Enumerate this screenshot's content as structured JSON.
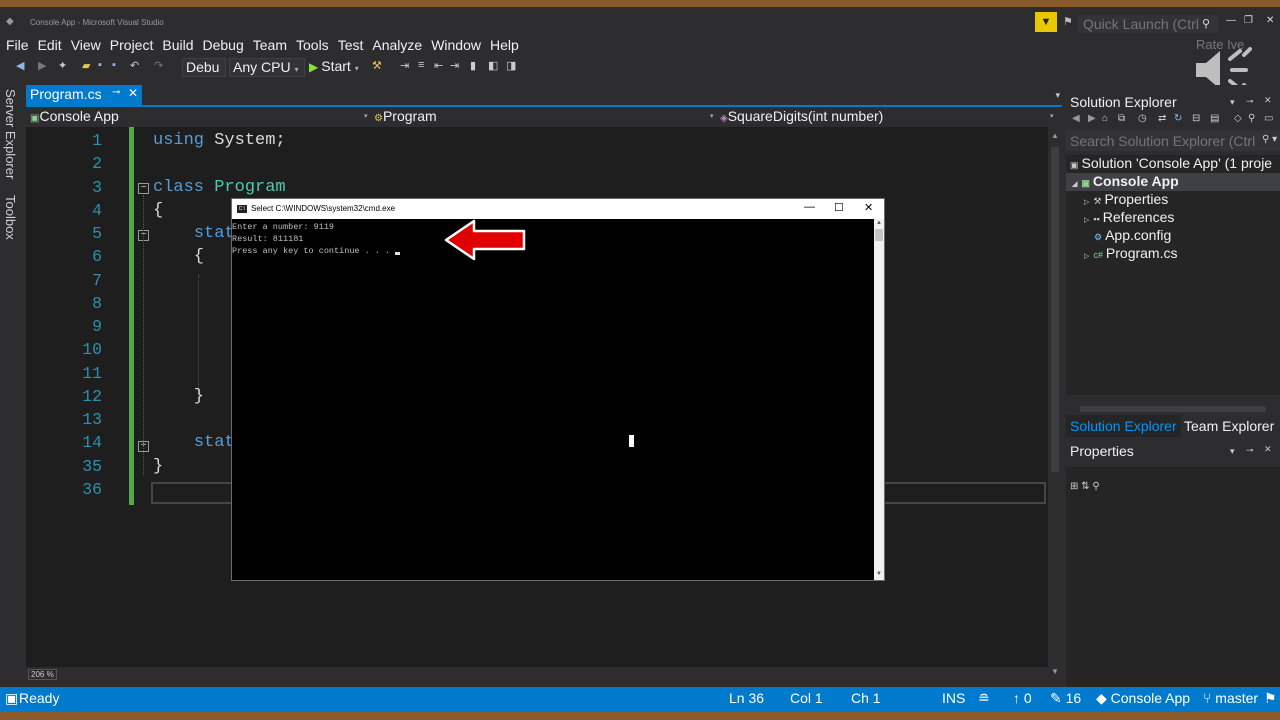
{
  "window": {
    "title": "Console App - Microsoft Visual Studio",
    "quick_launch_placeholder": "Quick Launch (Ctrl",
    "rate_label": "Rate Ive"
  },
  "menu": [
    "File",
    "Edit",
    "View",
    "Project",
    "Build",
    "Debug",
    "Team",
    "Tools",
    "Test",
    "Analyze",
    "Window",
    "Help"
  ],
  "toolbar": {
    "config": "Debu",
    "platform": "Any CPU",
    "start_label": "Start"
  },
  "side_tabs": [
    "Server Explorer",
    "Toolbox"
  ],
  "document_tab": {
    "label": "Program.cs",
    "close": "✕"
  },
  "navbar": {
    "project": "Console App",
    "type": "Program",
    "member": "SquareDigits(int number)"
  },
  "editor": {
    "line_numbers": [
      "1",
      "2",
      "3",
      "4",
      "5",
      "6",
      "7",
      "8",
      "9",
      "10",
      "11",
      "12",
      "13",
      "14",
      "35",
      "36"
    ],
    "zoom": "206 %"
  },
  "cmd": {
    "title": "Select C:\\WINDOWS\\system32\\cmd.exe",
    "lines": [
      "Enter a number: 9119",
      "Result: 811181",
      "Press any key to continue . . ."
    ]
  },
  "solution_explorer": {
    "title": "Solution Explorer",
    "search_placeholder": "Search Solution Explorer (Ctrl",
    "items": [
      {
        "label": "Solution 'Console App' (1 proje"
      },
      {
        "label": "Console App"
      },
      {
        "label": "Properties"
      },
      {
        "label": "References"
      },
      {
        "label": "App.config"
      },
      {
        "label": "Program.cs"
      }
    ],
    "tabs": [
      "Solution Explorer",
      "Team Explorer"
    ]
  },
  "properties": {
    "title": "Properties"
  },
  "status": {
    "state": "Ready",
    "ln": "Ln 36",
    "col": "Col 1",
    "ch": "Ch 1",
    "mode": "INS",
    "pending": "0",
    "commits": "16",
    "repo": "Console App",
    "branch": "master"
  },
  "colors": {
    "accent": "#007acc",
    "editor_bg": "#1e1e1e",
    "keyword": "#569cd6",
    "type": "#4ec9b0",
    "line_number": "#2b91af",
    "change_bar": "#57a64a",
    "arrow": "#e00000"
  }
}
